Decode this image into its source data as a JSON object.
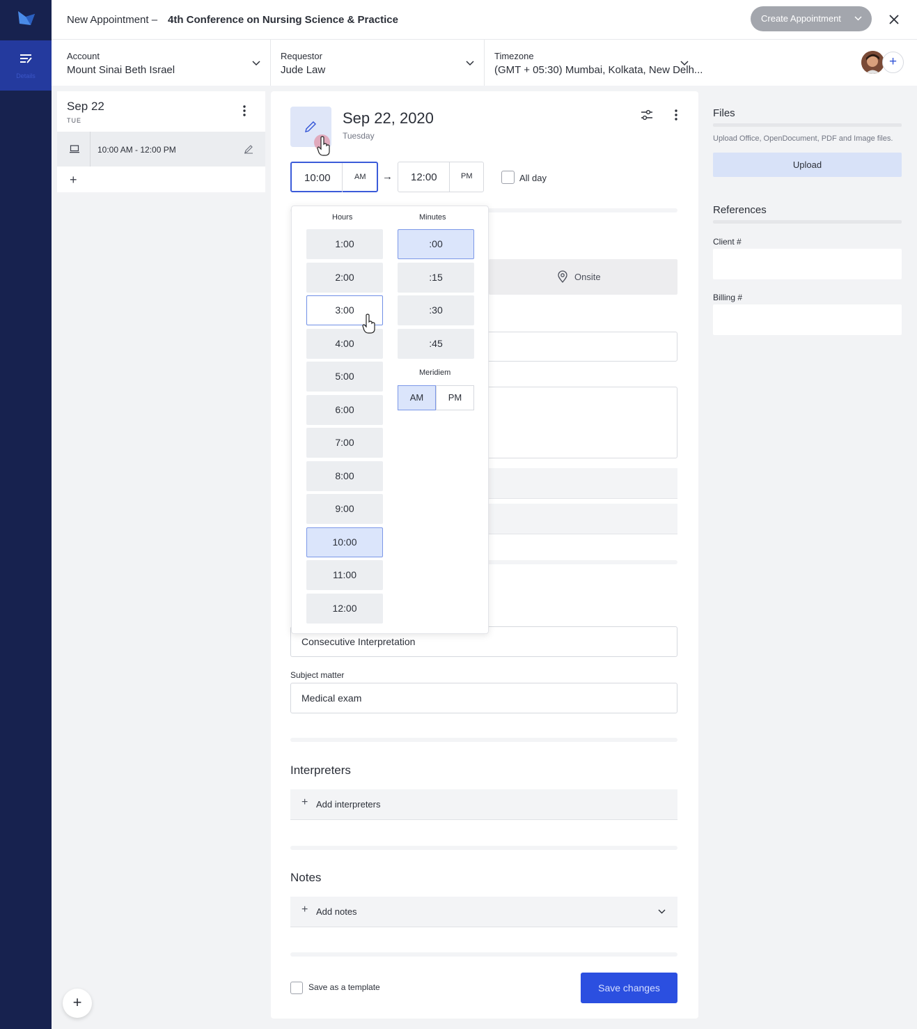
{
  "header": {
    "title_prefix": "New Appointment –",
    "title_main": "4th Conference on Nursing Science & Practice",
    "create_button": "Create Appointment"
  },
  "rail": {
    "nav_label": "Details"
  },
  "info": {
    "account_label": "Account",
    "account_value": "Mount Sinai Beth Israel",
    "requestor_label": "Requestor",
    "requestor_value": "Jude Law",
    "timezone_label": "Timezone",
    "timezone_value": "(GMT + 05:30) Mumbai, Kolkata, New Delh..."
  },
  "date_column": {
    "title": "Sep 22",
    "weekday": "TUE",
    "slot": "10:00 AM - 12:00 PM"
  },
  "main": {
    "date": "Sep 22, 2020",
    "weekday": "Tuesday",
    "start_time": "10:00",
    "start_meridiem": "AM",
    "end_time": "12:00",
    "end_meridiem": "PM",
    "all_day_label": "All day",
    "onsite_label": "Onsite",
    "service_value": "Consecutive Interpretation",
    "subject_label": "Subject matter",
    "subject_value": "Medical exam",
    "interpreters_title": "Interpreters",
    "add_interpreters": "Add interpreters",
    "notes_title": "Notes",
    "add_notes": "Add notes",
    "save_template_label": "Save as a template",
    "save_button": "Save changes"
  },
  "picker": {
    "hours_label": "Hours",
    "minutes_label": "Minutes",
    "meridiem_label": "Meridiem",
    "hours": [
      "1:00",
      "2:00",
      "3:00",
      "4:00",
      "5:00",
      "6:00",
      "7:00",
      "8:00",
      "9:00",
      "10:00",
      "11:00",
      "12:00"
    ],
    "selected_hour": "10:00",
    "hovered_hour": "3:00",
    "minutes": [
      ":00",
      ":15",
      ":30",
      ":45"
    ],
    "selected_minute": ":00",
    "meridiems": [
      "AM",
      "PM"
    ],
    "selected_meridiem": "AM"
  },
  "right_panel": {
    "files_title": "Files",
    "files_hint": "Upload Office, OpenDocument, PDF and Image files.",
    "upload_button": "Upload",
    "references_title": "References",
    "client_label": "Client #",
    "billing_label": "Billing #"
  },
  "colors": {
    "accent": "#2b4fe0",
    "rail": "#17224f",
    "rail_active": "#243a9e",
    "selection": "#dbe5fb"
  }
}
